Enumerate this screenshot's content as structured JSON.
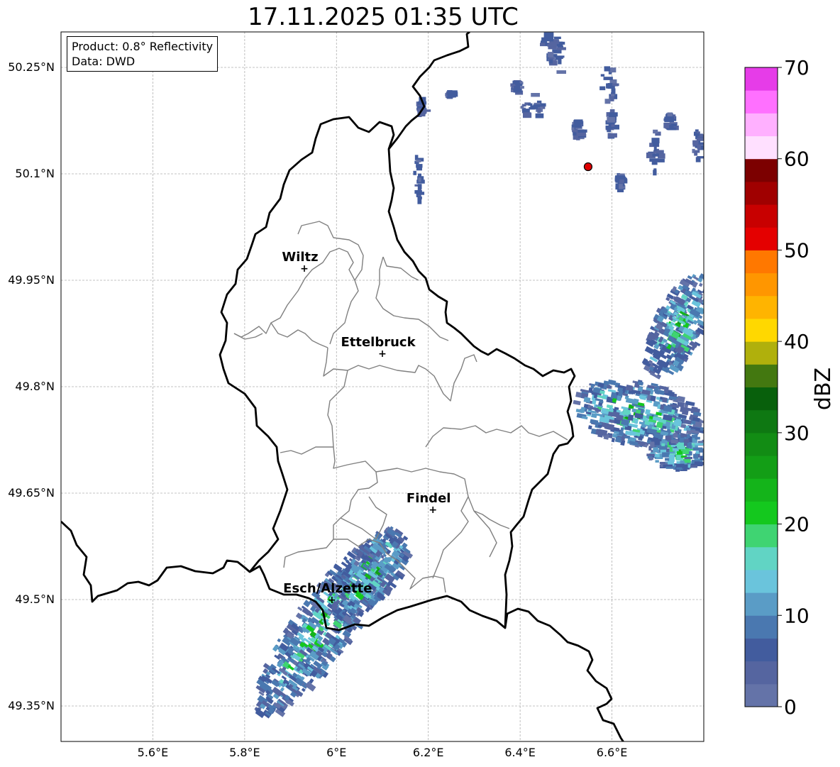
{
  "title": "17.11.2025 01:35 UTC",
  "info": {
    "product": "Product: 0.8° Reflectivity",
    "data": "Data: DWD"
  },
  "map": {
    "lat_ticks": [
      {
        "value": 50.25,
        "label": "50.25°N"
      },
      {
        "value": 50.1,
        "label": "50.1°N"
      },
      {
        "value": 49.95,
        "label": "49.95°N"
      },
      {
        "value": 49.8,
        "label": "49.8°N"
      },
      {
        "value": 49.65,
        "label": "49.65°N"
      },
      {
        "value": 49.5,
        "label": "49.5°N"
      },
      {
        "value": 49.35,
        "label": "49.35°N"
      }
    ],
    "lon_ticks": [
      {
        "value": 5.6,
        "label": "5.6°E"
      },
      {
        "value": 5.8,
        "label": "5.8°E"
      },
      {
        "value": 6.0,
        "label": "6°E"
      },
      {
        "value": 6.2,
        "label": "6.2°E"
      },
      {
        "value": 6.4,
        "label": "6.4°E"
      },
      {
        "value": 6.6,
        "label": "6.6°E"
      }
    ],
    "extent": {
      "lon": [
        5.4,
        6.8
      ],
      "lat": [
        49.3,
        50.3
      ]
    },
    "grid": true,
    "cities": [
      {
        "name": "Wiltz",
        "lon": 5.93,
        "lat": 49.967
      },
      {
        "name": "Ettelbruck",
        "lon": 6.1,
        "lat": 49.847
      },
      {
        "name": "Findel",
        "lon": 6.21,
        "lat": 49.627
      },
      {
        "name": "Esch/Alzette",
        "lon": 5.99,
        "lat": 49.5
      }
    ],
    "radar_site": {
      "lon": 6.548,
      "lat": 50.11,
      "color": "#e00000"
    }
  },
  "colorbar": {
    "label": "dBZ",
    "ticks": [
      "0",
      "10",
      "20",
      "30",
      "40",
      "50",
      "60",
      "70"
    ],
    "min": 0,
    "max": 70,
    "step": 2.5,
    "colors": [
      "#6473a8",
      "#5565a0",
      "#425c9e",
      "#4a78b0",
      "#5a9cc6",
      "#6ac4dc",
      "#61d4c4",
      "#3fd472",
      "#14c81e",
      "#14b41a",
      "#139e16",
      "#128c14",
      "#0e7812",
      "#08600c",
      "#437810",
      "#b0b00c",
      "#ffd800",
      "#ffb400",
      "#ff9600",
      "#ff7800",
      "#e40000",
      "#c80000",
      "#a00000",
      "#7c0000",
      "#ffe0ff",
      "#ffb0ff",
      "#ff70ff",
      "#e63ce8"
    ]
  }
}
